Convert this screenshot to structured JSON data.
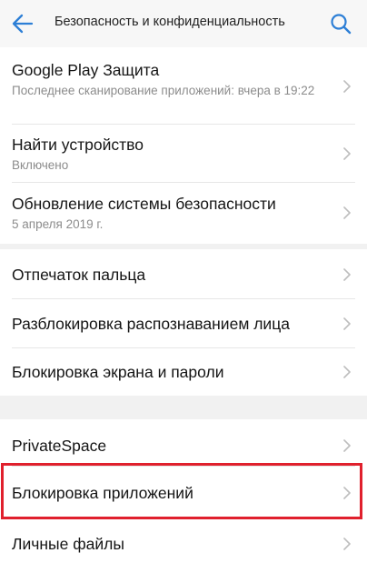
{
  "header": {
    "title": "Безопасность и конфиденциальность",
    "back_icon": "arrow-left-icon",
    "search_icon": "search-icon",
    "accent": "#2d7fd6"
  },
  "groups": [
    {
      "items": [
        {
          "label": "Google Play Защита",
          "subtitle": "Последнее сканирование приложений: вчера в 19:22"
        },
        {
          "label": "Найти устройство",
          "subtitle": "Включено"
        },
        {
          "label": "Обновление системы безопасности",
          "subtitle": "5 апреля 2019 г."
        }
      ]
    },
    {
      "items": [
        {
          "label": "Отпечаток пальца"
        },
        {
          "label": "Разблокировка распознаванием лица"
        },
        {
          "label": "Блокировка экрана и пароли"
        }
      ]
    },
    {
      "items": [
        {
          "label": "PrivateSpace"
        },
        {
          "label": "Блокировка приложений",
          "highlighted": true
        },
        {
          "label": "Личные файлы"
        }
      ]
    }
  ],
  "colors": {
    "highlight_border": "#e0202d",
    "chevron": "#bdbdbd"
  }
}
